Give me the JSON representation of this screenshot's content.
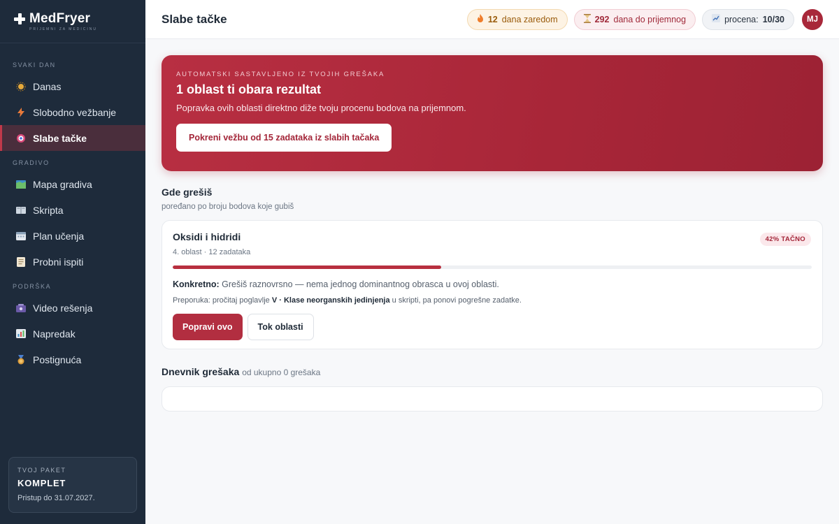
{
  "brand": {
    "name": "MedFryer",
    "tagline": "prijemni za medicinu"
  },
  "sidebar": {
    "sections": [
      {
        "label": "Svaki dan",
        "items": [
          {
            "label": "Danas",
            "icon": "sun-icon"
          },
          {
            "label": "Slobodno vežbanje",
            "icon": "lightning-icon"
          },
          {
            "label": "Slabe tačke",
            "icon": "target-icon",
            "active": true
          }
        ]
      },
      {
        "label": "Gradivo",
        "items": [
          {
            "label": "Mapa gradiva",
            "icon": "map-icon"
          },
          {
            "label": "Skripta",
            "icon": "book-icon"
          },
          {
            "label": "Plan učenja",
            "icon": "calendar-icon"
          },
          {
            "label": "Probni ispiti",
            "icon": "document-icon"
          }
        ]
      },
      {
        "label": "Podrška",
        "items": [
          {
            "label": "Video rešenja",
            "icon": "video-icon"
          },
          {
            "label": "Napredak",
            "icon": "chart-icon"
          },
          {
            "label": "Postignuća",
            "icon": "medal-icon"
          }
        ]
      }
    ],
    "package": {
      "label": "Tvoj paket",
      "name": "KOMPLET",
      "access": "Pristup do 31.07.2027."
    }
  },
  "header": {
    "title": "Slabe tačke",
    "streak": {
      "num": "12",
      "text": "dana zaredom",
      "icon": "fire-icon"
    },
    "days_left": {
      "num": "292",
      "text": "dana do prijemnog",
      "icon": "hourglass-icon"
    },
    "score": {
      "label": "procena:",
      "value": "10/30",
      "icon": "trend-icon"
    },
    "avatar": "MJ"
  },
  "hero": {
    "kicker": "Automatski sastavljeno iz tvojih grešaka",
    "title": "1 oblast ti obara rezultat",
    "subtitle": "Popravka ovih oblasti direktno diže tvoju procenu bodova na prijemnom.",
    "button": "Pokreni vežbu od 15 zadataka iz slabih tačaka"
  },
  "weak_spots": {
    "title": "Gde grešiš",
    "subtitle": "poređano po broju bodova koje gubiš",
    "items": [
      {
        "title": "Oksidi i hidridi",
        "meta": "4. oblast · 12 zadataka",
        "badge": "42% TAČNO",
        "accuracy": 0.42,
        "detail_label": "Konkretno:",
        "detail_text": "Grešiš raznovrsno — nema jednog dominantnog obrasca u ovoj oblasti.",
        "reco_prefix": "Preporuka: pročitaj poglavlje",
        "reco_chapter": "V · Klase neorganskih jedinjenja",
        "reco_suffix": "u skripti, pa ponovi pogrešne zadatke.",
        "primary_button": "Popravi ovo",
        "secondary_button": "Tok oblasti"
      }
    ]
  },
  "log": {
    "title": "Dnevnik grešaka",
    "subtitle": "od ukupno 0 grešaka"
  },
  "colors": {
    "accent": "#b22e40",
    "sidebar": "#1e2b3b"
  }
}
